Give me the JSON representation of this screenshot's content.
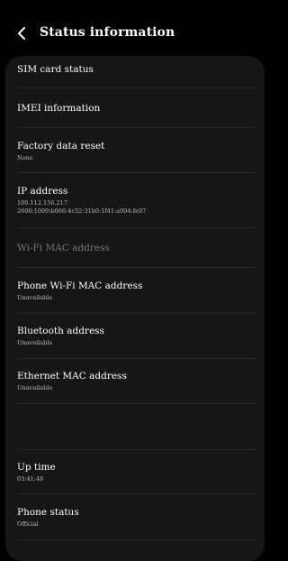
{
  "header": {
    "title": "Status information"
  },
  "items": [
    {
      "title": "SIM card status"
    },
    {
      "title": "IMEI information"
    },
    {
      "title": "Factory data reset",
      "sub": "None"
    },
    {
      "title": "IP address",
      "sub": "100.112.156.217",
      "sub2": "2600:1009:b066:4c52:31b0:1f41:a004:fe97"
    },
    {
      "title": "Wi-Fi MAC address"
    },
    {
      "title": "Phone Wi-Fi MAC address",
      "sub": "Unavailable"
    },
    {
      "title": "Bluetooth address",
      "sub": "Unavailable"
    },
    {
      "title": "Ethernet MAC address",
      "sub": "Unavailable"
    },
    {
      "title": "Up time",
      "sub": "03:41:48"
    },
    {
      "title": "Phone status",
      "sub": "Official"
    }
  ],
  "colors": {
    "background": "#000000",
    "card": "#161616",
    "text": "#ffffff",
    "disabled_text": "#7a7a7a",
    "subtext": "#bcbcbc"
  },
  "icons": {
    "back": "back-arrow-icon"
  }
}
